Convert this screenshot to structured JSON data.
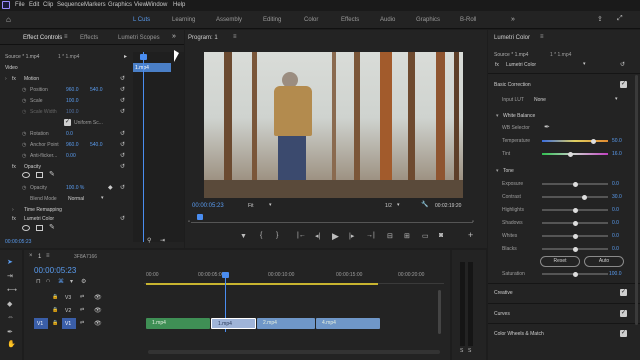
{
  "menu": [
    "File",
    "Edit",
    "Clip",
    "Sequence",
    "Markers",
    "Graphics",
    "View",
    "Window",
    "Help"
  ],
  "workspaces": [
    "Learning",
    "Assembly",
    "Editing",
    "Color",
    "Effects",
    "Audio",
    "Graphics",
    "B-Roll"
  ],
  "workspace_active": "L Cuts",
  "effect_controls": {
    "tab_effect_controls": "Effect Controls",
    "tab_effects": "Effects",
    "tab_lumetri_scopes": "Lumetri Scopes",
    "source": "Source * 1.mp4",
    "sequence": "1 * 1.mp4",
    "clip_label": "1.mp4",
    "video_label": "Video",
    "motion": "Motion",
    "position_label": "Position",
    "position_x": "960.0",
    "position_y": "540.0",
    "scale_label": "Scale",
    "scale_val": "100.0",
    "scale_width_label": "Scale Width",
    "scale_width_val": "100.0",
    "uniform_scale": "Uniform Sc...",
    "rotation_label": "Rotation",
    "rotation_val": "0.0",
    "anchor_label": "Anchor Point",
    "anchor_x": "960.0",
    "anchor_y": "540.0",
    "antiflicker_label": "Anti-flicker...",
    "antiflicker_val": "0.00",
    "opacity": "Opacity",
    "opacity_label": "Opacity",
    "opacity_val": "100.0 %",
    "blend_label": "Blend Mode",
    "blend_val": "Normal",
    "time_remap": "Time Remapping",
    "lumetri": "Lumetri Color",
    "timecode": "00:00:05:23"
  },
  "program": {
    "title": "Program: 1",
    "timecode": "00:00:05:23",
    "fit": "Fit",
    "quality": "1/2",
    "duration": "00:02:19:20"
  },
  "timeline": {
    "tab": "1",
    "extra_tab": "3F8A7166",
    "timecode": "00:00:05:23",
    "ruler": [
      "00:00",
      "00:00:05:00",
      "00:00:10:00",
      "00:00:15:00",
      "00:00:20:00"
    ],
    "tracks": [
      "V3",
      "V2",
      "V1"
    ],
    "source_patch": "V1",
    "clips": [
      "1.mp4",
      "1.mp4",
      "2.mp4",
      "4.mp4"
    ]
  },
  "lumetri": {
    "title": "Lumetri Color",
    "source": "Source * 1.mp4",
    "sequence": "1 * 1.mp4",
    "fx_name": "Lumetri Color",
    "basic_correction": "Basic Correction",
    "input_lut_label": "Input LUT",
    "input_lut_val": "None",
    "white_balance": "White Balance",
    "wb_selector": "WB Selector",
    "temperature_label": "Temperature",
    "temperature_val": "50.0",
    "tint_label": "Tint",
    "tint_val": "16.0",
    "tone": "Tone",
    "exposure_label": "Exposure",
    "exposure_val": "0.0",
    "contrast_label": "Contrast",
    "contrast_val": "30.0",
    "highlights_label": "Highlights",
    "highlights_val": "0.0",
    "shadows_label": "Shadows",
    "shadows_val": "0.0",
    "whites_label": "Whites",
    "whites_val": "0.0",
    "blacks_label": "Blacks",
    "blacks_val": "0.0",
    "reset": "Reset",
    "auto": "Auto",
    "saturation_label": "Saturation",
    "saturation_val": "100.0",
    "creative": "Creative",
    "curves": "Curves",
    "color_wheels": "Color Wheels & Match"
  },
  "colors": {
    "accent": "#5a9cf0",
    "clip_green": "#3f8f55",
    "clip_blue": "#6f97c8",
    "playhead": "#4a8df0"
  }
}
